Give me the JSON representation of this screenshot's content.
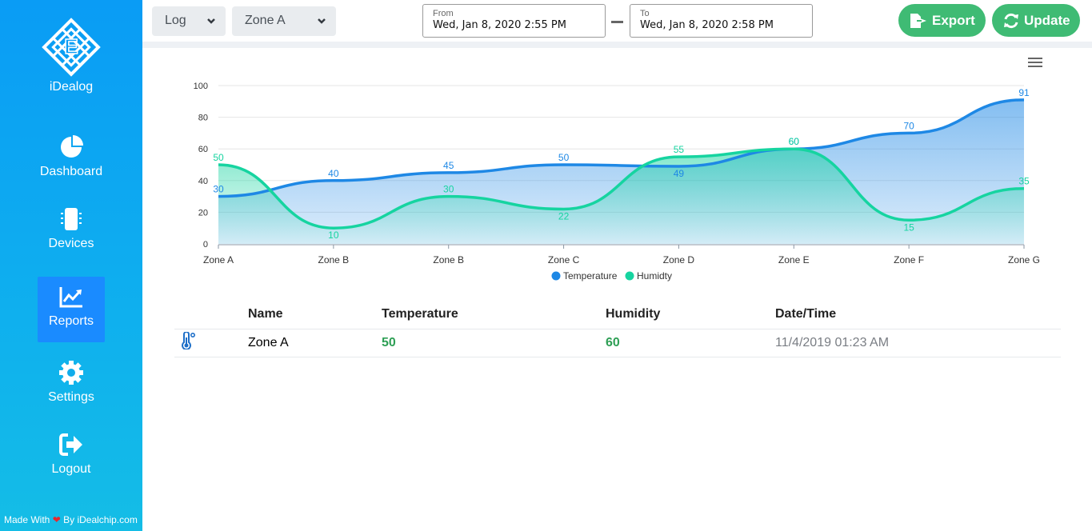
{
  "sidebar": {
    "brand": "iDealog",
    "items": [
      {
        "label": "Dashboard",
        "icon": "pie-chart-icon"
      },
      {
        "label": "Devices",
        "icon": "device-icon"
      },
      {
        "label": "Reports",
        "icon": "line-chart-icon",
        "active": true
      },
      {
        "label": "Settings",
        "icon": "gear-icon"
      },
      {
        "label": "Logout",
        "icon": "logout-icon"
      }
    ],
    "footer": {
      "made_with": "Made With",
      "by": "By iDealchip.com"
    }
  },
  "toolbar": {
    "mode_select": "Log",
    "zone_select": "Zone A",
    "from_caption": "From",
    "from_value": "Wed, Jan 8, 2020 2:55 PM",
    "to_caption": "To",
    "to_value": "Wed, Jan 8, 2020 2:58 PM",
    "export_label": "Export",
    "update_label": "Update"
  },
  "colors": {
    "accent": "#0a9cf5",
    "temperature": "#1e88e5",
    "humidity": "#16d4a0",
    "button_green": "#3fbb74"
  },
  "chart_data": {
    "type": "area",
    "categories": [
      "Zone A",
      "Zone B",
      "Zone B",
      "Zone C",
      "Zone D",
      "Zone E",
      "Zone F",
      "Zone G"
    ],
    "series": [
      {
        "name": "Temperature",
        "values": [
          30,
          40,
          45,
          50,
          49,
          60,
          70,
          91
        ]
      },
      {
        "name": "Humidty",
        "values": [
          50,
          10,
          30,
          22,
          55,
          60,
          15,
          35
        ]
      }
    ],
    "ylim": [
      0,
      100
    ],
    "yticks": [
      0,
      20,
      40,
      60,
      80,
      100
    ],
    "grid": true,
    "legend": "bottom-center",
    "data_labels": true
  },
  "table": {
    "headers": [
      "Name",
      "Temperature",
      "Humidity",
      "Date/Time"
    ],
    "rows": [
      {
        "icon": "thermometer-icon",
        "name": "Zone A",
        "temperature": "50",
        "humidity": "60",
        "datetime": "11/4/2019 01:23 AM"
      }
    ]
  }
}
